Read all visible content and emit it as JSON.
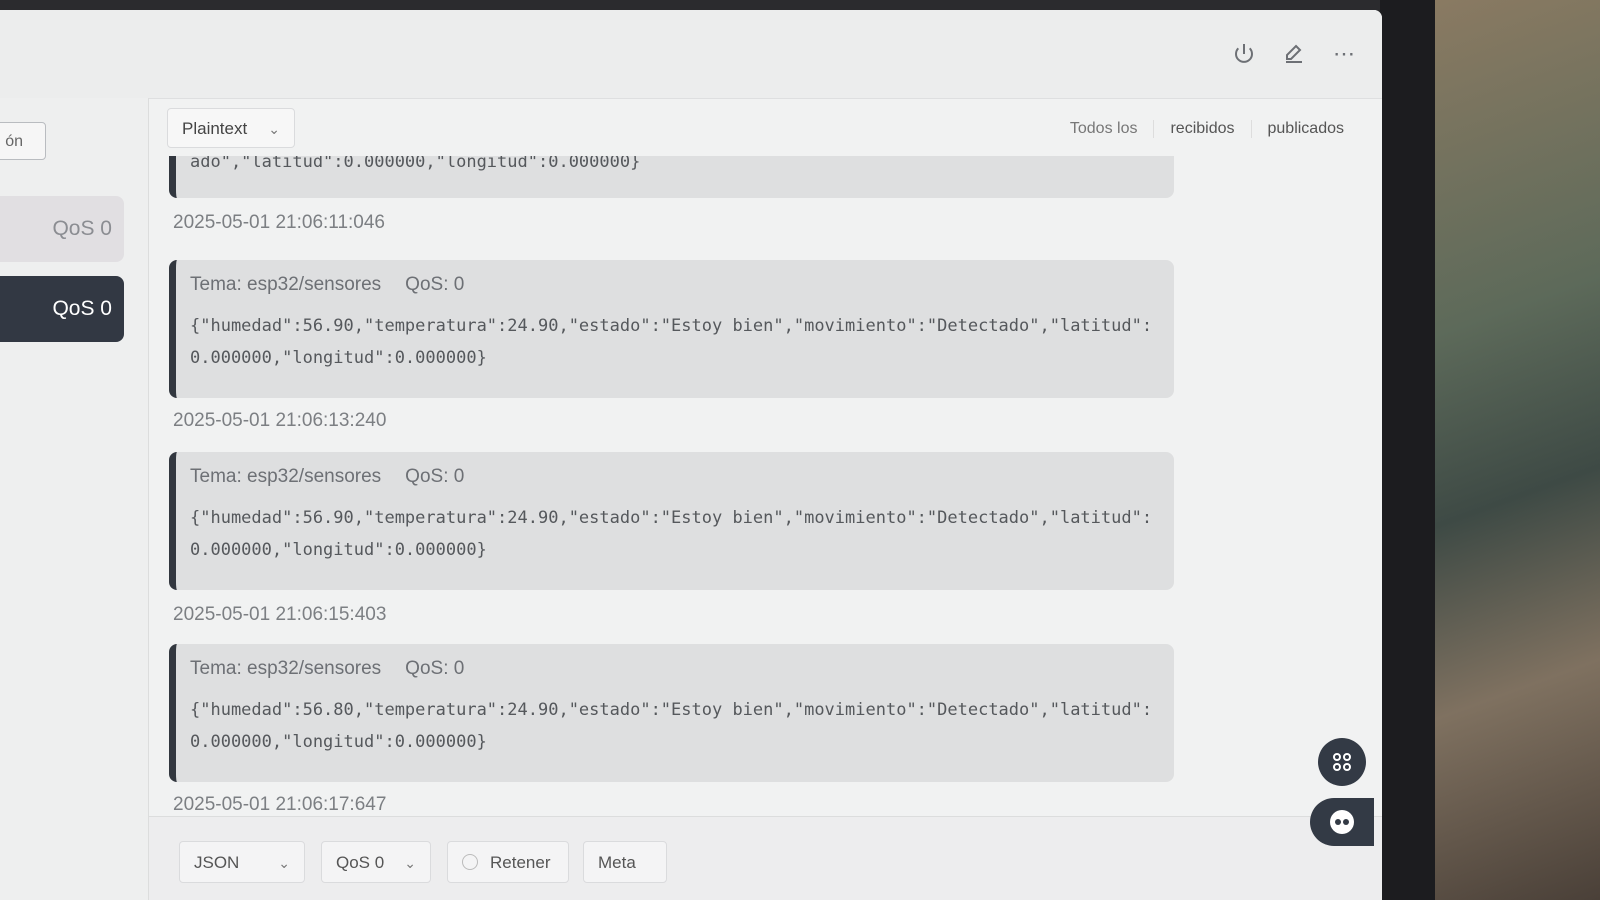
{
  "topbar": {
    "icons": [
      "power-icon",
      "edit-icon",
      "more-icon"
    ]
  },
  "sidebar": {
    "partial_button": "ón",
    "items": [
      {
        "label": "QoS 0",
        "active": false
      },
      {
        "label": "QoS 0",
        "active": true
      }
    ]
  },
  "main": {
    "format_select": "Plaintext",
    "filters": [
      "Todos los",
      "recibidos",
      "publicados"
    ],
    "messages": [
      {
        "topic": "",
        "qos": "",
        "payload": "ado\",\"latitud\":0.000000,\"longitud\":0.000000}",
        "time": "2025-05-01 21:06:11:046"
      },
      {
        "topic": "Tema: esp32/sensores",
        "qos": "QoS: 0",
        "payload": "{\"humedad\":56.90,\"temperatura\":24.90,\"estado\":\"Estoy bien\",\"movimiento\":\"Detectado\",\"latitud\":0.000000,\"longitud\":0.000000}",
        "time": "2025-05-01 21:06:13:240"
      },
      {
        "topic": "Tema: esp32/sensores",
        "qos": "QoS: 0",
        "payload": "{\"humedad\":56.90,\"temperatura\":24.90,\"estado\":\"Estoy bien\",\"movimiento\":\"Detectado\",\"latitud\":0.000000,\"longitud\":0.000000}",
        "time": "2025-05-01 21:06:15:403"
      },
      {
        "topic": "Tema: esp32/sensores",
        "qos": "QoS: 0",
        "payload": "{\"humedad\":56.80,\"temperatura\":24.90,\"estado\":\"Estoy bien\",\"movimiento\":\"Detectado\",\"latitud\":0.000000,\"longitud\":0.000000}",
        "time": "2025-05-01 21:06:17:647"
      }
    ]
  },
  "bottom": {
    "payload_format": "JSON",
    "qos": "QoS 0",
    "retain_label": "Retener",
    "meta_label": "Meta"
  }
}
